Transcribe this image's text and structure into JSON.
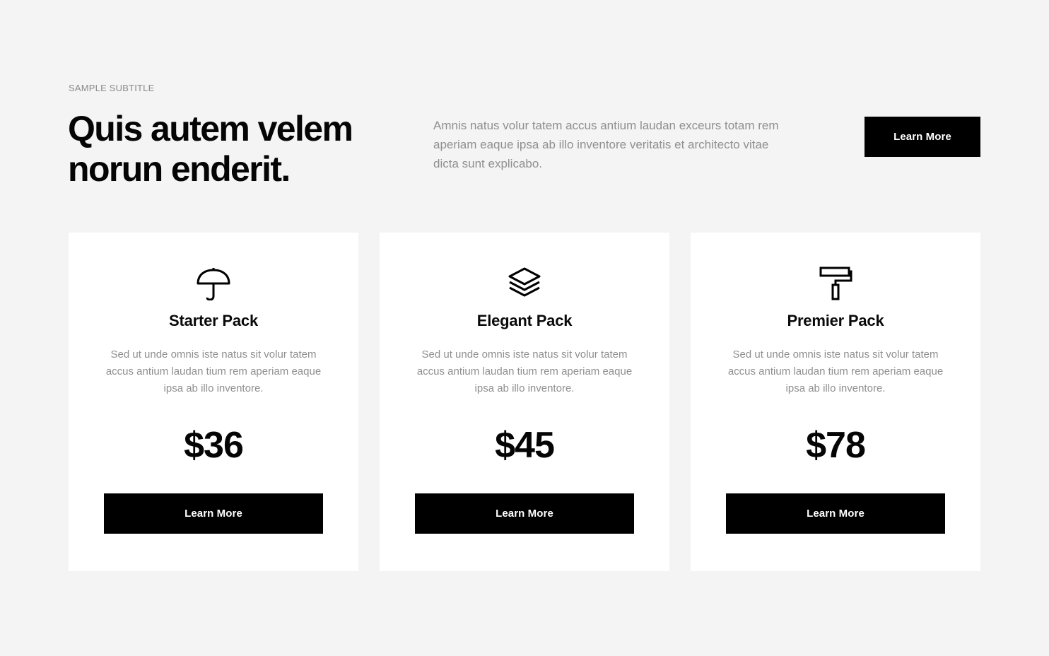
{
  "header": {
    "subtitle": "SAMPLE SUBTITLE",
    "headline_line1": "Quis autem velem",
    "headline_line2": "norun enderit.",
    "intro": "Amnis natus volur tatem accus antium laudan exceurs totam rem aperiam eaque ipsa ab illo inventore veritatis et architecto vitae dicta sunt explicabo.",
    "button_label": "Learn More"
  },
  "cards": [
    {
      "icon": "umbrella-icon",
      "title": "Starter Pack",
      "description": "Sed ut unde omnis iste natus sit volur tatem accus antium laudan tium rem aperiam eaque ipsa ab illo inventore.",
      "price": "$36",
      "button_label": "Learn More"
    },
    {
      "icon": "layers-icon",
      "title": "Elegant Pack",
      "description": "Sed ut unde omnis iste natus sit volur tatem accus antium laudan tium rem aperiam eaque ipsa ab illo inventore.",
      "price": "$45",
      "button_label": "Learn More"
    },
    {
      "icon": "paint-roller-icon",
      "title": "Premier Pack",
      "description": "Sed ut unde omnis iste natus sit volur tatem accus antium laudan tium rem aperiam eaque ipsa ab illo inventore.",
      "price": "$78",
      "button_label": "Learn More"
    }
  ],
  "colors": {
    "background": "#f4f4f4",
    "card": "#ffffff",
    "button": "#000000",
    "muted_text": "#8f8f8f"
  }
}
